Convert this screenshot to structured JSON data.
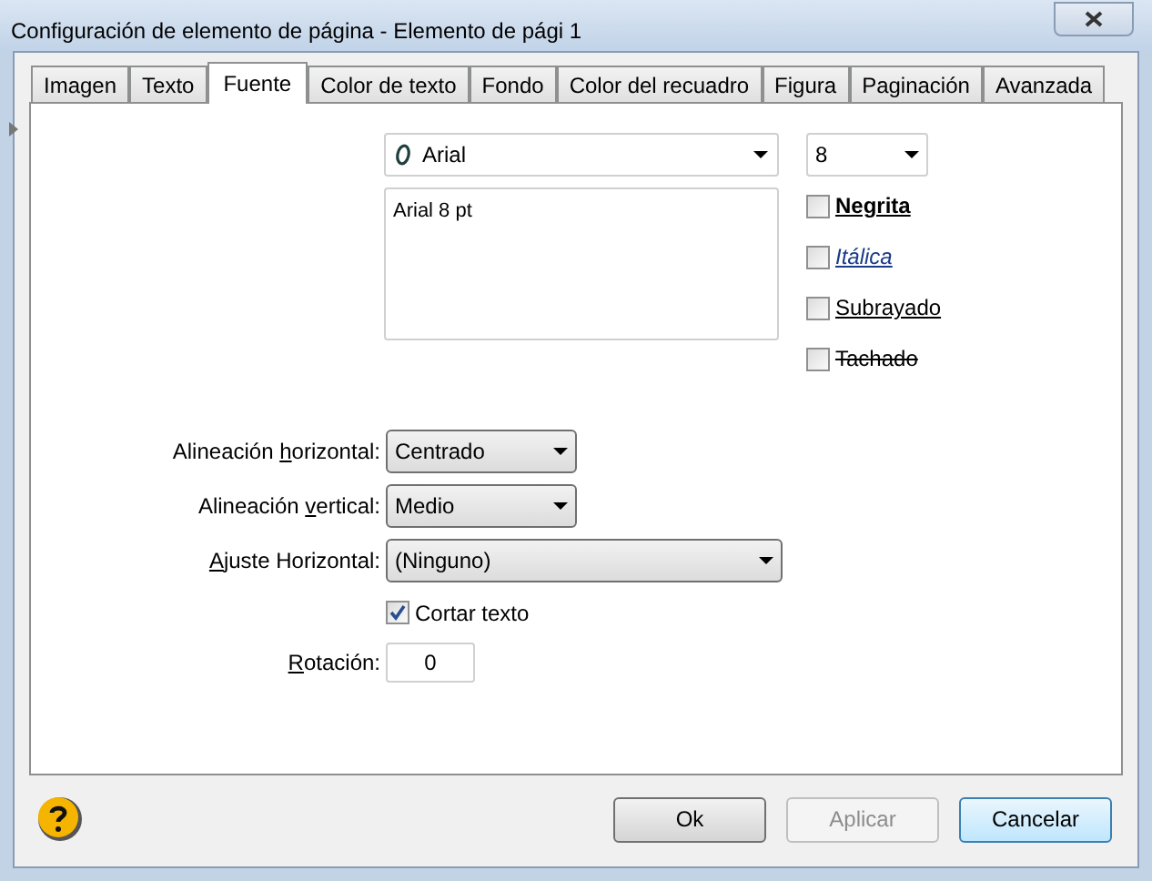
{
  "window": {
    "title": "Configuración de elemento de página - Elemento de pági 1"
  },
  "tabs": [
    {
      "label": "Imagen",
      "selected": false
    },
    {
      "label": "Texto",
      "selected": false
    },
    {
      "label": "Fuente",
      "selected": true
    },
    {
      "label": "Color de texto",
      "selected": false
    },
    {
      "label": "Fondo",
      "selected": false
    },
    {
      "label": "Color del recuadro",
      "selected": false
    },
    {
      "label": "Figura",
      "selected": false
    },
    {
      "label": "Paginación",
      "selected": false
    },
    {
      "label": "Avanzada",
      "selected": false
    }
  ],
  "font": {
    "family": "Arial",
    "size": "8",
    "preview": "Arial 8 pt"
  },
  "styles": [
    {
      "kind": "bold",
      "label": "Negrita",
      "checked": false
    },
    {
      "kind": "italic",
      "label": "Itálica",
      "checked": false
    },
    {
      "kind": "underline",
      "label": "Subrayado",
      "checked": false
    },
    {
      "kind": "strike",
      "label": "Tachado",
      "checked": false
    }
  ],
  "fields": [
    {
      "kind": "select",
      "label": {
        "before": "Alineación ",
        "key": "h",
        "after": "orizontal:"
      },
      "value": "Centrado",
      "wide": false
    },
    {
      "kind": "select",
      "label": {
        "before": "Alineación ",
        "key": "v",
        "after": "ertical:"
      },
      "value": "Medio",
      "wide": false
    },
    {
      "kind": "select",
      "label": {
        "key": "A",
        "after": "juste Horizontal:"
      },
      "value": "(Ninguno)",
      "wide": true
    },
    {
      "kind": "checkbox",
      "label": "Cortar texto",
      "checked": true
    },
    {
      "kind": "input",
      "label": {
        "key": "R",
        "after": "otación:"
      },
      "value": "0"
    }
  ],
  "buttons": [
    {
      "label": "Ok",
      "disabled": false,
      "default": false
    },
    {
      "label": "Aplicar",
      "disabled": true,
      "default": false
    },
    {
      "label": "Cancelar",
      "disabled": false,
      "default": true
    }
  ]
}
